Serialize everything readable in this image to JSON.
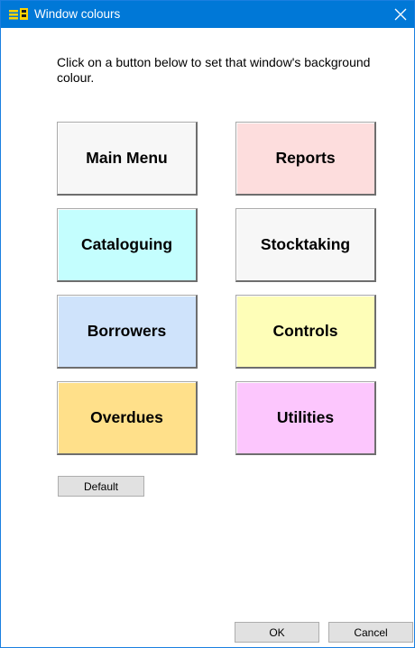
{
  "window": {
    "title": "Window colours",
    "instruction": "Click on a button below to set that window's background colour."
  },
  "colour_buttons": [
    {
      "label": "Main Menu",
      "color": "#f7f7f7"
    },
    {
      "label": "Reports",
      "color": "#fddddd"
    },
    {
      "label": "Cataloguing",
      "color": "#c4fefe"
    },
    {
      "label": "Stocktaking",
      "color": "#f7f7f7"
    },
    {
      "label": "Borrowers",
      "color": "#cfe3fb"
    },
    {
      "label": "Controls",
      "color": "#fefeb8"
    },
    {
      "label": "Overdues",
      "color": "#ffe08a"
    },
    {
      "label": "Utilities",
      "color": "#fcc6fd"
    }
  ],
  "buttons": {
    "default_label": "Default",
    "ok_label": "OK",
    "cancel_label": "Cancel"
  },
  "theme": {
    "titlebar_color": "#0078d7",
    "button_face": "#e1e1e1"
  }
}
